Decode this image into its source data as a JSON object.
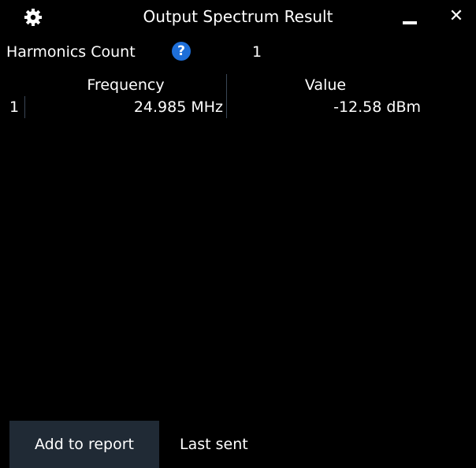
{
  "window": {
    "title": "Output Spectrum Result",
    "settings_icon": "gear-icon",
    "minimize_icon": "minimize-icon",
    "close_icon": "close-icon",
    "close_glyph": "✕"
  },
  "harmonics": {
    "label": "Harmonics Count",
    "help_icon": "help-icon",
    "help_glyph": "?",
    "value": "1"
  },
  "table": {
    "headers": [
      "",
      "Frequency",
      "Value"
    ],
    "rows": [
      {
        "index": "1",
        "frequency": "24.985 MHz",
        "value": "-12.58 dBm"
      }
    ]
  },
  "footer": {
    "add_to_report_label": "Add to report",
    "last_sent_label": "Last sent"
  },
  "colors": {
    "background": "#000000",
    "header_row": "#1e2a38",
    "data_row": "#0c1118",
    "button": "#202a35",
    "help_badge": "#1e6fd9"
  }
}
